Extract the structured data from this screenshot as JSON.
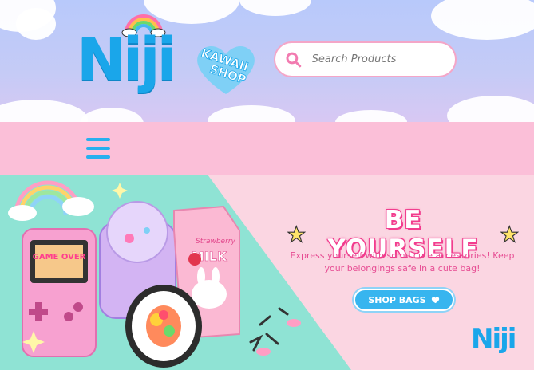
{
  "header": {
    "logo_text": "Niji",
    "tagline_line1": "KAWAII",
    "tagline_line2": "SHOP"
  },
  "search": {
    "placeholder": "Search Products"
  },
  "nav": {
    "menu_icon": "hamburger-icon"
  },
  "hero": {
    "title": "BE YOURSELF",
    "description": "Express yourself with some cute accessories! Keep your belongings safe in a cute bag!",
    "cta_label": "SHOP BAGS",
    "cta_icon": "heart-icon",
    "game_screen_text": "GAME OVER",
    "milk_label": "MILK",
    "milk_brand": "Strawberry",
    "footer_logo": "Niji"
  },
  "colors": {
    "brand_blue": "#1aa6ea",
    "pink": "#fbbfd8",
    "accent_pink": "#f23d8e",
    "teal": "#8fe3d4"
  }
}
